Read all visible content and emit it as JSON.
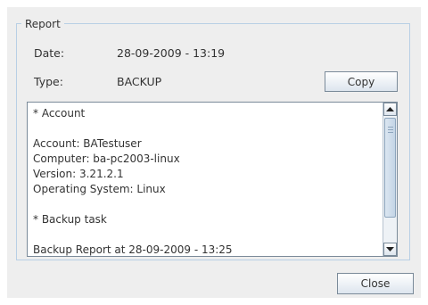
{
  "report": {
    "legend": "Report",
    "date_label": "Date:",
    "date_value": "28-09-2009 - 13:19",
    "type_label": "Type:",
    "type_value": "BACKUP",
    "copy_label": "Copy",
    "lines": [
      "* Account",
      "",
      "Account: BATestuser",
      "Computer: ba-pc2003-linux",
      "Version: 3.21.2.1",
      "Operating System: Linux",
      "",
      "* Backup task",
      "",
      "Backup Report at 28-09-2009 - 13:25"
    ]
  },
  "footer": {
    "close_label": "Close"
  }
}
